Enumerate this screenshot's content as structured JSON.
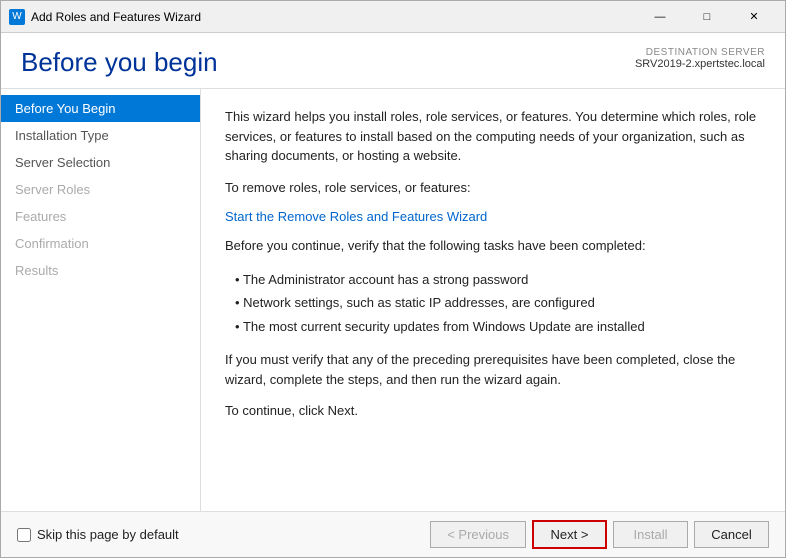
{
  "window": {
    "title": "Add Roles and Features Wizard",
    "icon": "W"
  },
  "titlebar": {
    "minimize": "—",
    "maximize": "□",
    "close": "✕"
  },
  "header": {
    "title": "Before you begin",
    "destination_label": "DESTINATION SERVER",
    "server_name": "SRV2019-2.xpertstec.local"
  },
  "sidebar": {
    "items": [
      {
        "label": "Before You Begin",
        "state": "active"
      },
      {
        "label": "Installation Type",
        "state": "normal"
      },
      {
        "label": "Server Selection",
        "state": "normal"
      },
      {
        "label": "Server Roles",
        "state": "disabled"
      },
      {
        "label": "Features",
        "state": "disabled"
      },
      {
        "label": "Confirmation",
        "state": "disabled"
      },
      {
        "label": "Results",
        "state": "disabled"
      }
    ]
  },
  "content": {
    "para1": "This wizard helps you install roles, role services, or features. You determine which roles, role services, or features to install based on the computing needs of your organization, such as sharing documents, or hosting a website.",
    "para2": "To remove roles, role services, or features:",
    "remove_link": "Start the Remove Roles and Features Wizard",
    "para3": "Before you continue, verify that the following tasks have been completed:",
    "bullets": [
      "The Administrator account has a strong password",
      "Network settings, such as static IP addresses, are configured",
      "The most current security updates from Windows Update are installed"
    ],
    "para4": "If you must verify that any of the preceding prerequisites have been completed, close the wizard, complete the steps, and then run the wizard again.",
    "para5": "To continue, click Next."
  },
  "footer": {
    "checkbox_label": "Skip this page by default",
    "previous_btn": "< Previous",
    "next_btn": "Next >",
    "install_btn": "Install",
    "cancel_btn": "Cancel"
  }
}
